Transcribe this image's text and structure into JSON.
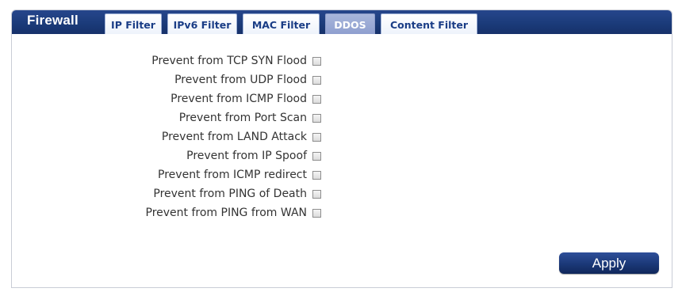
{
  "header": {
    "title": "Firewall"
  },
  "tabs": [
    {
      "label": "IP Filter",
      "active": false
    },
    {
      "label": "IPv6 Filter",
      "active": false
    },
    {
      "label": "MAC Filter",
      "active": false
    },
    {
      "label": "DDOS",
      "active": true
    },
    {
      "label": "Content Filter",
      "active": false
    }
  ],
  "options": [
    {
      "label": "Prevent from TCP SYN Flood",
      "checked": false
    },
    {
      "label": "Prevent from UDP Flood",
      "checked": false
    },
    {
      "label": "Prevent from ICMP Flood",
      "checked": false
    },
    {
      "label": "Prevent from Port Scan",
      "checked": false
    },
    {
      "label": "Prevent from LAND Attack",
      "checked": false
    },
    {
      "label": "Prevent from IP Spoof",
      "checked": false
    },
    {
      "label": "Prevent from ICMP redirect",
      "checked": false
    },
    {
      "label": "Prevent from PING of Death",
      "checked": false
    },
    {
      "label": "Prevent from PING from WAN",
      "checked": false
    }
  ],
  "apply_label": "Apply",
  "colors": {
    "header": "#1a3a78",
    "active_tab": "#9aa9d6",
    "tab_text": "#1a3d86"
  }
}
